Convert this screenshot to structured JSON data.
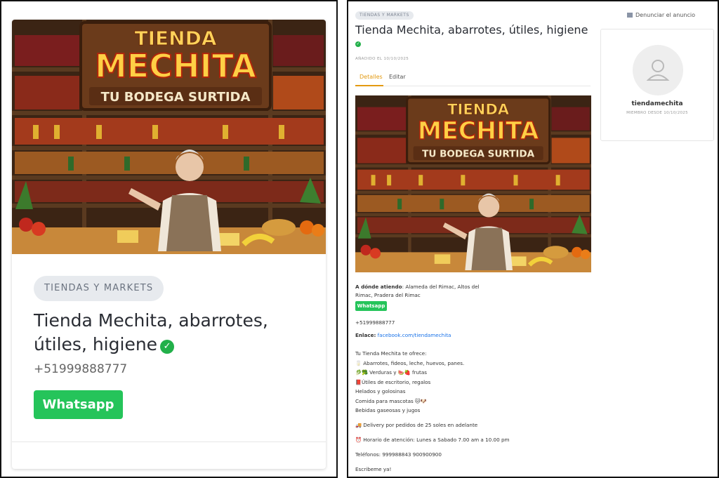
{
  "card": {
    "category": "TIENDAS Y MARKETS",
    "title": "Tienda Mechita, abarrotes, útiles, higiene",
    "phone": "+51999888777",
    "whatsapp_label": "Whatsapp"
  },
  "banner": {
    "line1": "TIENDA",
    "line2": "MECHITA",
    "line3": "TU BODEGA SURTIDA"
  },
  "detail": {
    "category": "TIENDAS Y MARKETS",
    "report_label": "Denunciar el anuncio",
    "title": "Tienda Mechita, abarrotes, útiles, higiene",
    "date": "AÑADIDO EL 10/10/2025",
    "tabs": [
      "Detalles",
      "Editar"
    ],
    "where_label": "A dónde atiendo",
    "where_value": ": Alameda del Rimac, Altos del",
    "where_value2": "Rimac, Pradera del Rimac",
    "whatsapp_label": "Whatsapp",
    "phone": "+51999888777",
    "link_label": "Enlace:",
    "link_value": "facebook.com/tiendamechita",
    "description": [
      "Tu Tienda Mechita te ofrece:",
      "🥛 Abarrotes, fideos, leche, huevos, panes.",
      "🥬🥦 Verduras y 🍉🍓 frutas",
      "📕Útiles de escritorio, regalos",
      "Helados y golosinas",
      "Comida para mascotas 🐱🐶",
      "Bebidas gaseosas y jugos",
      "🚚 Delivery por pedidos de 25 soles en adelante",
      "⏰ Horario de atención: Lunes a Sabado 7.00 am a 10.00 pm",
      "Teléfonos: 999988843 900900900",
      "Escribeme ya!"
    ]
  },
  "seller": {
    "name": "tiendamechita",
    "member_since": "MIEMBRO DESDE 10/10/2025"
  },
  "colors": {
    "whatsapp": "#25c45a",
    "verified": "#22b04a",
    "tab_active": "#e39a11",
    "link": "#1a73e8",
    "chip_bg": "#e7eaee"
  }
}
